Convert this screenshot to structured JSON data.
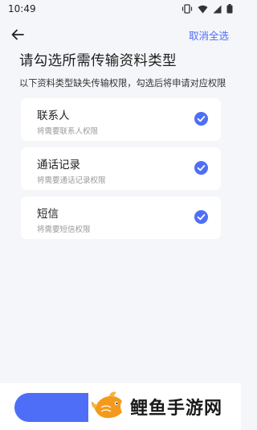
{
  "status_bar": {
    "time": "10:49"
  },
  "header": {
    "deselect_all_label": "取消全选"
  },
  "page": {
    "title": "请勾选所需传输资料类型",
    "subtitle": "以下资料类型缺失传输权限，勾选后将申请对应权限"
  },
  "permissions": [
    {
      "name": "联系人",
      "description": "将需要联系人权限",
      "checked": true
    },
    {
      "name": "通话记录",
      "description": "将需要通话记录权限",
      "checked": true
    },
    {
      "name": "短信",
      "description": "将需要短信权限",
      "checked": true
    }
  ],
  "watermark": {
    "text": "鲤鱼手游网"
  },
  "colors": {
    "accent": "#4f6ef7",
    "background": "#f5f6f9",
    "card": "#ffffff"
  }
}
